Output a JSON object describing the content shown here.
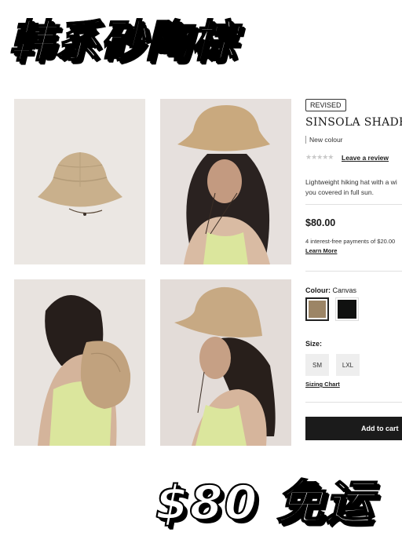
{
  "overlay": {
    "top_text": "韩系砂陶棕",
    "bottom_text": "$80 免运"
  },
  "product": {
    "badge": "REVISED",
    "title": "SINSOLA SHADE HAT",
    "new_colour": "New colour",
    "stars": "★★★★★",
    "review_link": "Leave a review",
    "description_line1": "Lightweight hiking hat with a wi",
    "description_line2": "you covered in full sun.",
    "price": "$80.00",
    "installments": "4 interest-free payments of $20.00",
    "learn_more": "Learn More",
    "colour_label": "Colour:",
    "colour_value": "Canvas",
    "swatches": [
      {
        "name": "Canvas",
        "color": "#9c8566"
      },
      {
        "name": "Black",
        "color": "#101110"
      }
    ],
    "size_label": "Size:",
    "sizes": [
      "SM",
      "LXL"
    ],
    "sizing_chart": "Sizing Chart",
    "add_to_cart": "Add to cart"
  },
  "images": [
    {
      "name": "hat-product-shot"
    },
    {
      "name": "model-front-view"
    },
    {
      "name": "model-back-view"
    },
    {
      "name": "model-side-view"
    }
  ]
}
